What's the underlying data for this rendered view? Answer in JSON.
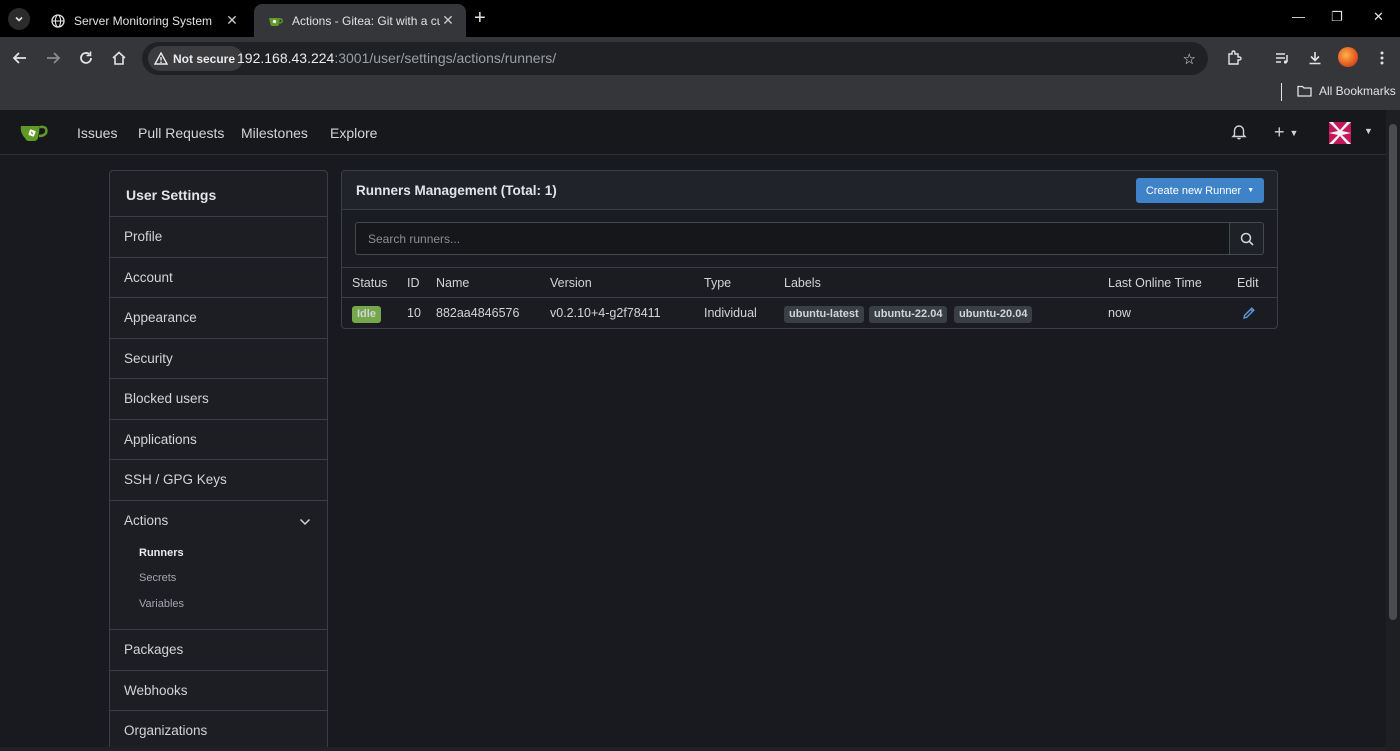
{
  "browser": {
    "tabs": [
      {
        "title": "Server Monitoring System",
        "active": false
      },
      {
        "title": "Actions - Gitea: Git with a cup of tea",
        "active": true
      }
    ],
    "security_label": "Not secure",
    "url_host": "192.168.43.224",
    "url_rest": ":3001/user/settings/actions/runners/",
    "bookmarks_label": "All Bookmarks"
  },
  "nav": {
    "items": [
      "Issues",
      "Pull Requests",
      "Milestones",
      "Explore"
    ]
  },
  "sidebar": {
    "header": "User Settings",
    "items_top": [
      "Profile",
      "Account",
      "Appearance",
      "Security",
      "Blocked users",
      "Applications",
      "SSH / GPG Keys"
    ],
    "group_title": "Actions",
    "group_items": [
      "Runners",
      "Secrets",
      "Variables"
    ],
    "items_bottom": [
      "Packages",
      "Webhooks",
      "Organizations"
    ]
  },
  "panel": {
    "title": "Runners Management (Total: 1)",
    "create_button": "Create new Runner",
    "search_placeholder": "Search runners..."
  },
  "table": {
    "headers": [
      "Status",
      "ID",
      "Name",
      "Version",
      "Type",
      "Labels",
      "Last Online Time",
      "Edit"
    ],
    "rows": [
      {
        "status": "Idle",
        "id": "10",
        "name": "882aa4846576",
        "version": "v0.2.10+4-g2f78411",
        "type": "Individual",
        "labels": [
          "ubuntu-latest",
          "ubuntu-22.04",
          "ubuntu-20.04"
        ],
        "last_online": "now"
      }
    ]
  },
  "colors": {
    "accent": "#3e82c8",
    "status_idle": "#76a74b",
    "gitea_green": "#609926"
  }
}
